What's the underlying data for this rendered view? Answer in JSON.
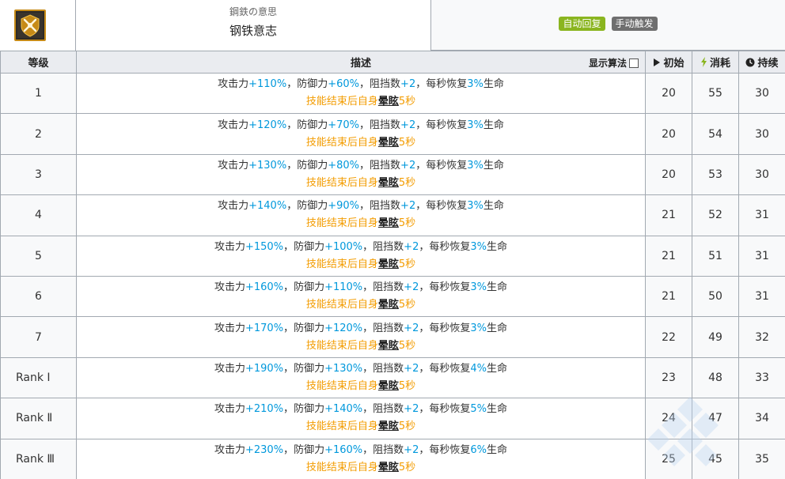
{
  "skill": {
    "name_jp": "鋼鉄の意思",
    "name_cn": "钢铁意志",
    "tags": [
      "自动回复",
      "手动触发"
    ],
    "icon": "crossed-swords-shield-icon"
  },
  "table": {
    "headers": {
      "level": "等级",
      "desc": "描述",
      "show_formula": "显示算法",
      "initial": "初始",
      "cost": "消耗",
      "duration": "持续"
    },
    "desc_text": {
      "atk": "攻击力",
      "def": "防御力",
      "block": "阻挡数",
      "block_val": "+2",
      "regen": "每秒恢复",
      "hp": "生命",
      "sep": "，",
      "line2_prefix": "技能结束后自身",
      "stun": "晕眩",
      "stun_time": "5秒"
    },
    "rows": [
      {
        "level": "1",
        "atk": "+110%",
        "def": "+60%",
        "regen": "3%",
        "initial": "20",
        "cost": "55",
        "duration": "30",
        "rank": false
      },
      {
        "level": "2",
        "atk": "+120%",
        "def": "+70%",
        "regen": "3%",
        "initial": "20",
        "cost": "54",
        "duration": "30",
        "rank": false
      },
      {
        "level": "3",
        "atk": "+130%",
        "def": "+80%",
        "regen": "3%",
        "initial": "20",
        "cost": "53",
        "duration": "30",
        "rank": false
      },
      {
        "level": "4",
        "atk": "+140%",
        "def": "+90%",
        "regen": "3%",
        "initial": "21",
        "cost": "52",
        "duration": "31",
        "rank": false
      },
      {
        "level": "5",
        "atk": "+150%",
        "def": "+100%",
        "regen": "3%",
        "initial": "21",
        "cost": "51",
        "duration": "31",
        "rank": false
      },
      {
        "level": "6",
        "atk": "+160%",
        "def": "+110%",
        "regen": "3%",
        "initial": "21",
        "cost": "50",
        "duration": "31",
        "rank": false
      },
      {
        "level": "7",
        "atk": "+170%",
        "def": "+120%",
        "regen": "3%",
        "initial": "22",
        "cost": "49",
        "duration": "32",
        "rank": false
      },
      {
        "level": "Rank Ⅰ",
        "atk": "+190%",
        "def": "+130%",
        "regen": "4%",
        "initial": "23",
        "cost": "48",
        "duration": "33",
        "rank": true
      },
      {
        "level": "Rank Ⅱ",
        "atk": "+210%",
        "def": "+140%",
        "regen": "5%",
        "initial": "24",
        "cost": "47",
        "duration": "34",
        "rank": true
      },
      {
        "level": "Rank Ⅲ",
        "atk": "+230%",
        "def": "+160%",
        "regen": "6%",
        "initial": "25",
        "cost": "45",
        "duration": "35",
        "rank": true
      }
    ]
  },
  "colors": {
    "value_blue": "#0098dc",
    "stun_orange": "#f39c00",
    "tag_auto": "#8ab51f",
    "tag_manual": "#6f6f6f",
    "cost_icon": "#8ab51f"
  }
}
